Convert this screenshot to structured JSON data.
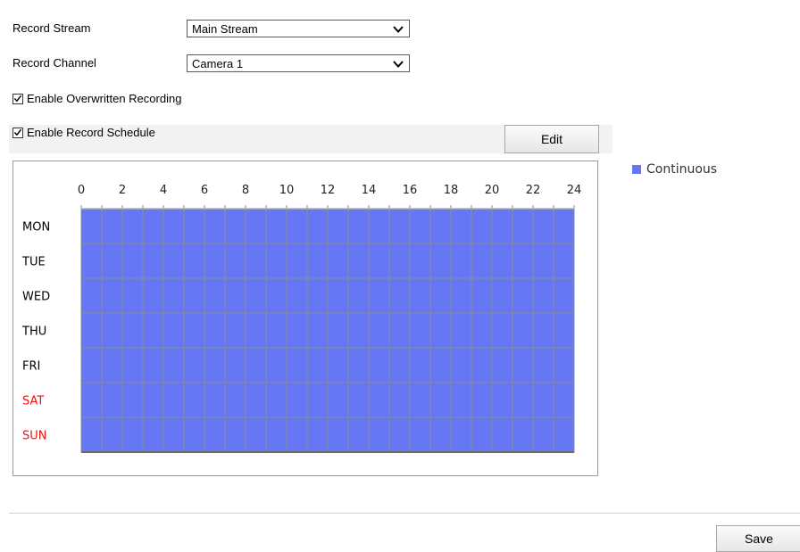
{
  "record_stream": {
    "label": "Record Stream",
    "value": "Main Stream"
  },
  "record_channel": {
    "label": "Record Channel",
    "value": "Camera 1"
  },
  "overwrite": {
    "label": "Enable Overwritten Recording",
    "checked": true
  },
  "record_schedule": {
    "label": "Enable Record Schedule",
    "checked": true
  },
  "edit_button": "Edit",
  "save_button": "Save",
  "legend": {
    "label": "Continuous",
    "color": "#6577f3"
  },
  "schedule": {
    "hour_labels": [
      "0",
      "2",
      "4",
      "6",
      "8",
      "10",
      "12",
      "14",
      "16",
      "18",
      "20",
      "22",
      "24"
    ],
    "days": [
      {
        "label": "MON",
        "color": "#000000"
      },
      {
        "label": "TUE",
        "color": "#000000"
      },
      {
        "label": "WED",
        "color": "#000000"
      },
      {
        "label": "THU",
        "color": "#000000"
      },
      {
        "label": "FRI",
        "color": "#000000"
      },
      {
        "label": "SAT",
        "color": "#ee1111"
      },
      {
        "label": "SUN",
        "color": "#ee1111"
      }
    ],
    "continuous_hours": {
      "start": 0,
      "end": 24
    },
    "cell_color": "#6577f3",
    "line_color": "#8a8f8a"
  }
}
